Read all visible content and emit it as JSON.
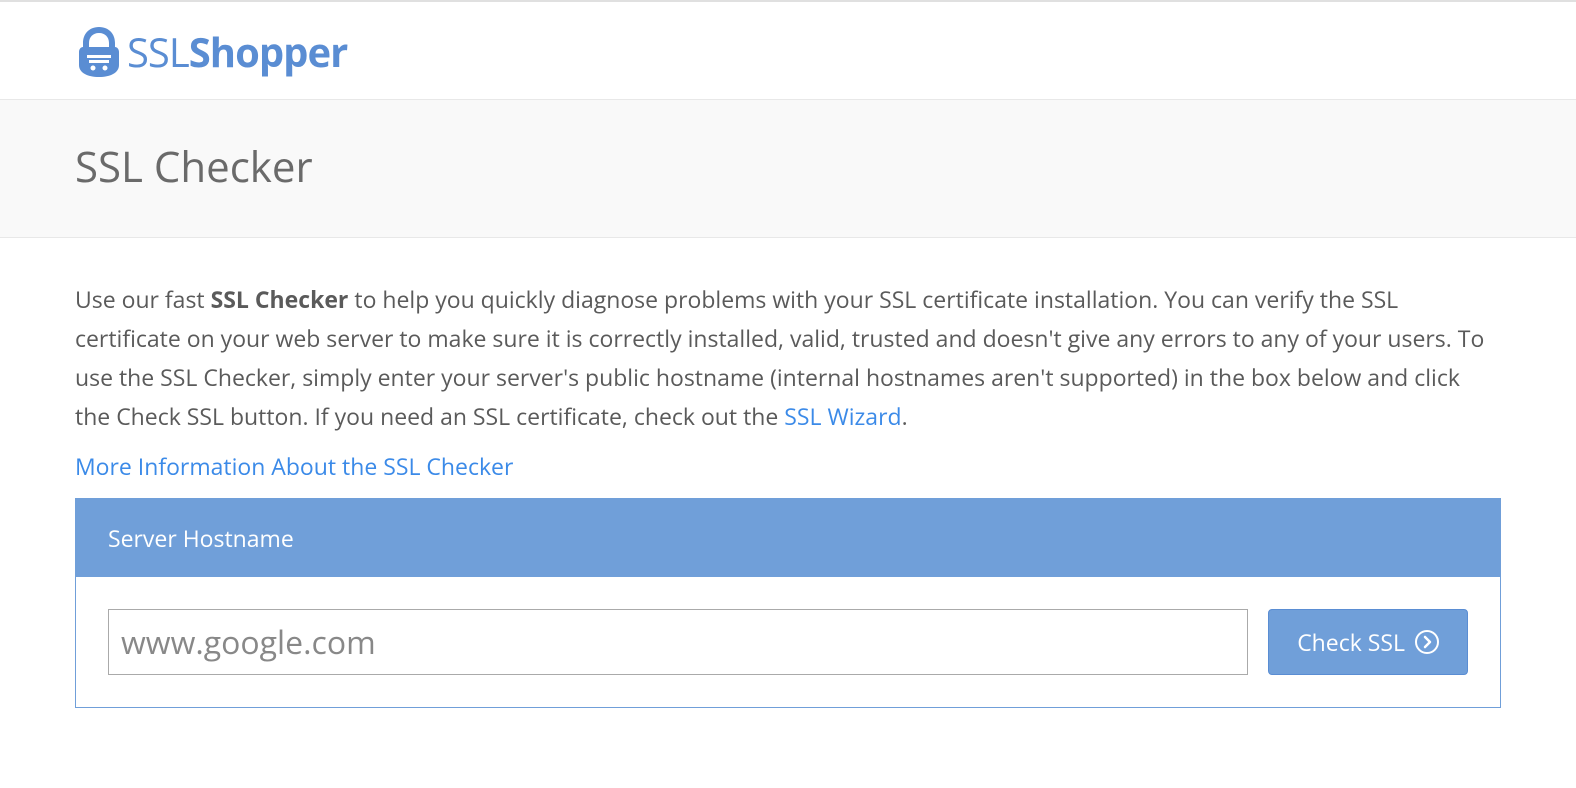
{
  "header": {
    "logo_ssl": "SSL",
    "logo_shopper": "Shopper"
  },
  "title": "SSL Checker",
  "description": {
    "part1": "Use our fast ",
    "bold": "SSL Checker",
    "part2": " to help you quickly diagnose problems with your SSL certificate installation. You can verify the SSL certificate on your web server to make sure it is correctly installed, valid, trusted and doesn't give any errors to any of your users. To use the SSL Checker, simply enter your server's public hostname (internal hostnames aren't supported) in the box below and click the Check SSL button. If you need an SSL certificate, check out the ",
    "wizard_link": "SSL Wizard",
    "part3": "."
  },
  "more_info_link": "More Information About the SSL Checker",
  "form": {
    "header": "Server Hostname",
    "placeholder": "www.google.com",
    "button_label": "Check SSL"
  }
}
